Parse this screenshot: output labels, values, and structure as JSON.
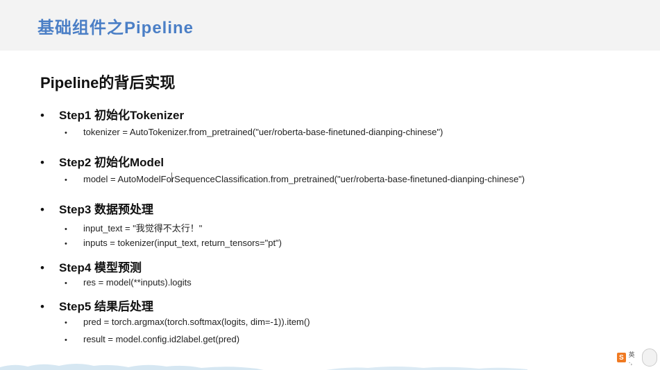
{
  "header": {
    "title": "基础组件之Pipeline"
  },
  "section": {
    "title": "Pipeline的背后实现"
  },
  "bullet_glyph": "•",
  "steps": [
    {
      "label": "Step1 初始化Tokenizer",
      "lines": [
        "tokenizer = AutoTokenizer.from_pretrained(\"uer/roberta-base-finetuned-dianping-chinese\")"
      ]
    },
    {
      "label": "Step2 初始化Model",
      "lines": [
        "model = AutoModelForSequenceClassification.from_pretrained(\"uer/roberta-base-finetuned-dianping-chinese\")"
      ]
    },
    {
      "label": "Step3 数据预处理",
      "lines": [
        "input_text = \"我觉得不太行！\"",
        "inputs = tokenizer(input_text, return_tensors=\"pt\")"
      ]
    },
    {
      "label": "Step4 模型预测",
      "lines": [
        "res = model(**inputs).logits"
      ]
    },
    {
      "label": "Step5 结果后处理",
      "lines": [
        "pred = torch.argmax(torch.softmax(logits, dim=-1)).item()",
        "result = model.config.id2label.get(pred)"
      ]
    }
  ],
  "tray": {
    "ime_icon": "sogou-s-icon",
    "ime_glyph": "S",
    "ime_text": "英 ·,",
    "mascot_icon": "mascot-icon"
  },
  "colors": {
    "title_accent": "#4b7fc6",
    "header_bg": "#f3f3f3",
    "cloud": "#cfe3f0"
  }
}
